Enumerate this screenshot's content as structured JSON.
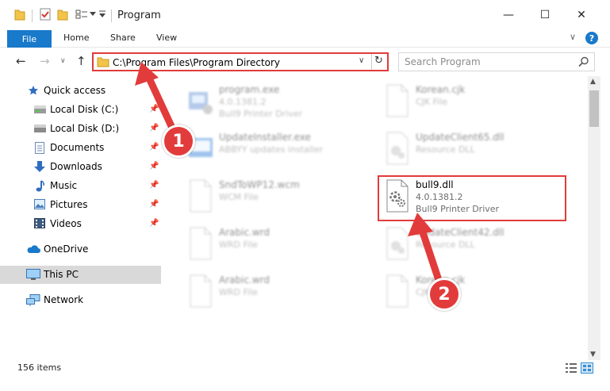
{
  "window": {
    "title": "Program",
    "minimize": "—",
    "maximize": "☐",
    "close": "✕"
  },
  "ribbon": {
    "tabs": [
      "File",
      "Home",
      "Share",
      "View"
    ],
    "help": "?",
    "collapse": "∨"
  },
  "nav": {
    "back": "←",
    "forward": "→",
    "recent": "∨",
    "up": "↑"
  },
  "address": {
    "path": "C:\\Program Files\\Program Directory",
    "dropdown": "∨",
    "refresh": "↻"
  },
  "search": {
    "placeholder": "Search Program"
  },
  "sidebar": {
    "items": [
      {
        "label": "Quick access",
        "icon": "star-icon"
      },
      {
        "label": "Local Disk (C:)",
        "icon": "drive-icon",
        "pinned": true
      },
      {
        "label": "Local Disk (D:)",
        "icon": "drive-icon",
        "pinned": true
      },
      {
        "label": "Documents",
        "icon": "documents-icon",
        "pinned": true
      },
      {
        "label": "Downloads",
        "icon": "downloads-icon",
        "pinned": true
      },
      {
        "label": "Music",
        "icon": "music-icon",
        "pinned": true
      },
      {
        "label": "Pictures",
        "icon": "pictures-icon",
        "pinned": true
      },
      {
        "label": "Videos",
        "icon": "videos-icon",
        "pinned": true
      },
      {
        "label": "OneDrive",
        "icon": "cloud-icon"
      },
      {
        "label": "This PC",
        "icon": "computer-icon",
        "selected": true
      },
      {
        "label": "Network",
        "icon": "network-icon"
      }
    ]
  },
  "files": [
    {
      "name": "program.exe",
      "line2": "4.0.1381.2",
      "line3": "Bull9 Printer Driver",
      "icon": "exe-icon"
    },
    {
      "name": "Korean.cjk",
      "line2": "CJK File",
      "line3": "",
      "icon": "file-icon"
    },
    {
      "name": "UpdateInstaller.exe",
      "line2": "ABBYY updates installer",
      "line3": "",
      "icon": "installer-icon"
    },
    {
      "name": "UpdateClient65.dll",
      "line2": "Resource DLL",
      "line3": "",
      "icon": "dll-icon"
    },
    {
      "name": "SndToWP12.wcm",
      "line2": "WCM File",
      "line3": "",
      "icon": "file-icon"
    },
    {
      "name": "bull9.dll",
      "line2": "4.0.1381.2",
      "line3": "Bull9 Printer Driver",
      "icon": "dll-gear-icon"
    },
    {
      "name": "Arabic.wrd",
      "line2": "WRD File",
      "line3": "",
      "icon": "file-icon"
    },
    {
      "name": "UpdateClient42.dll",
      "line2": "Resource DLL",
      "line3": "",
      "icon": "dll-icon"
    },
    {
      "name": "Arabic.wrd",
      "line2": "WRD File",
      "line3": "",
      "icon": "file-icon"
    },
    {
      "name": "Korean.cjk",
      "line2": "CJK File",
      "line3": "",
      "icon": "file-icon"
    }
  ],
  "status": {
    "count": "156 items"
  },
  "annotations": {
    "step1": "1",
    "step2": "2",
    "color": "#e23b3b"
  },
  "colors": {
    "accent": "#1979ca",
    "highlight": "#e23b3b",
    "selected": "#d9d9d9"
  }
}
